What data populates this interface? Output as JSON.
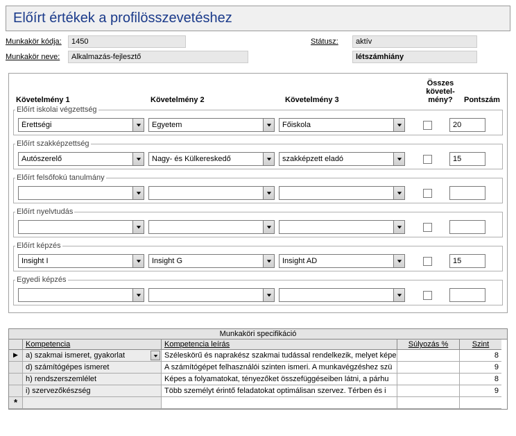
{
  "title": "Előírt értékek a profilösszevetéshez",
  "header": {
    "job_code_label": "Munkakör kódja:",
    "job_code_value": "1450",
    "status_label": "Státusz:",
    "status_value": "aktív",
    "job_name_label": "Munkakör neve:",
    "job_name_value": "Alkalmazás-fejlesztő",
    "status2_value": "létszámhiány"
  },
  "col_headers": {
    "r1": "Követelmény 1",
    "r2": "Követelmény 2",
    "r3": "Követelmény 3",
    "all": "Összes\nkövetel-\nmény?",
    "score": "Pontszám"
  },
  "groups": [
    {
      "legend": "Előírt iskolai végzettség",
      "req1": "Érettségi",
      "req2": "Egyetem",
      "req3": "Főiskola",
      "all": false,
      "score": "20"
    },
    {
      "legend": "Előírt szakképzettség",
      "req1": "Autószerelő",
      "req2": "Nagy- és Külkereskedő",
      "req3": "szakképzett eladó",
      "all": false,
      "score": "15"
    },
    {
      "legend": "Előírt felsőfokú tanulmány",
      "req1": "",
      "req2": "",
      "req3": "",
      "all": false,
      "score": ""
    },
    {
      "legend": "Előírt nyelvtudás",
      "req1": "",
      "req2": "",
      "req3": "",
      "all": false,
      "score": ""
    },
    {
      "legend": "Előírt képzés",
      "req1": "Insight I",
      "req2": "Insight G",
      "req3": "Insight AD",
      "all": false,
      "score": "15"
    },
    {
      "legend": "Egyedi képzés",
      "req1": "",
      "req2": "",
      "req3": "",
      "all": false,
      "score": ""
    }
  ],
  "spec": {
    "title": "Munkaköri specifikáció",
    "columns": {
      "komp": "Kompetencia",
      "desc": "Kompetencia leírás",
      "weight": "Súlyozás %",
      "level": "Szint"
    },
    "rows": [
      {
        "sel": true,
        "komp": "a) szakmai ismeret, gyakorlat",
        "desc": "Széleskörű és naprakész szakmai tudással rendelkezik, melyet képe",
        "weight": "",
        "level": "8"
      },
      {
        "sel": false,
        "komp": "d) számítógépes ismeret",
        "desc": "A számítógépet felhasználói szinten ismeri. A munkavégzéshez szü",
        "weight": "",
        "level": "9"
      },
      {
        "sel": false,
        "komp": "h) rendszerszemlélet",
        "desc": "Képes a folyamatokat, tényezőket összefüggéseiben látni, a párhu",
        "weight": "",
        "level": "8"
      },
      {
        "sel": false,
        "komp": "i) szervezőkészség",
        "desc": "Több személyt érintő feladatokat optimálisan szervez. Térben és i",
        "weight": "",
        "level": "9"
      }
    ]
  }
}
